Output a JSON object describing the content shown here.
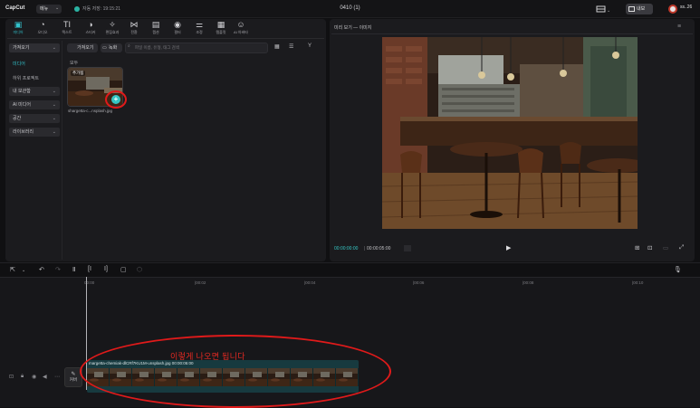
{
  "titlebar": {
    "logo": "CapCut",
    "menu_label": "메뉴",
    "autosave": "자동 저장: 19:15:21",
    "project_title": "0410 (1)",
    "export_label": "내보",
    "user_name": "ss..26"
  },
  "toolbar": {
    "items": [
      {
        "label": "미디어",
        "icon": "media-icon",
        "glyph": "▣"
      },
      {
        "label": "오디오",
        "icon": "audio-icon",
        "glyph": "◔"
      },
      {
        "label": "텍스트",
        "icon": "text-icon",
        "glyph": "TI"
      },
      {
        "label": "스티커",
        "icon": "sticker-icon",
        "glyph": "◑"
      },
      {
        "label": "편집효과",
        "icon": "effects-icon",
        "glyph": "✧"
      },
      {
        "label": "전환",
        "icon": "transition-icon",
        "glyph": "⋈"
      },
      {
        "label": "캡션",
        "icon": "caption-icon",
        "glyph": "▤"
      },
      {
        "label": "필터",
        "icon": "filter-icon",
        "glyph": "◉"
      },
      {
        "label": "조정",
        "icon": "adjust-icon",
        "glyph": "⚌"
      },
      {
        "label": "템플릿",
        "icon": "template-icon",
        "glyph": "▦"
      },
      {
        "label": "AI 아바타",
        "icon": "ai-avatar-icon",
        "glyph": "☺"
      }
    ],
    "active_index": 0
  },
  "sidebar": {
    "items": [
      {
        "label": "가져오기",
        "type": "dropdown"
      },
      {
        "label": "미디어",
        "type": "sub-current"
      },
      {
        "label": "하위 프로젝트",
        "type": "sub"
      },
      {
        "label": "내 보관함",
        "type": "dropdown"
      },
      {
        "label": "AI 미디어",
        "type": "dropdown"
      },
      {
        "label": "공간",
        "type": "dropdown"
      },
      {
        "label": "라이브러리",
        "type": "dropdown"
      }
    ]
  },
  "media": {
    "import_label": "가져오기",
    "record_label": "녹화",
    "search_placeholder": "파일 이름, 유형, 태그 검색",
    "all_label": "모두",
    "thumb_badge": "추가됨",
    "thumb_name": "shargetta-c...nsplash.jpg"
  },
  "preview": {
    "title": "미리 보기 — 이미지",
    "current_time": "00:00:00:00",
    "total_time": "00:00:05:00"
  },
  "timeline": {
    "ruler": [
      "00:00",
      "|00:02",
      "|00:04",
      "|00:06",
      "|00:08",
      "|00:10"
    ],
    "cover_label": "커버",
    "clip_label": "margetta-chemiak-dlCRf7KU1M-unsplash.jpg  00:00:05:00",
    "annotation": "이렇게 나오면 됩니다",
    "frame_count": 12
  },
  "colors": {
    "accent": "#32c2cc",
    "annotation_red": "#e01a1a",
    "clip_bg": "#173a3f",
    "background": "#101012",
    "panel": "#1b1b1e"
  }
}
